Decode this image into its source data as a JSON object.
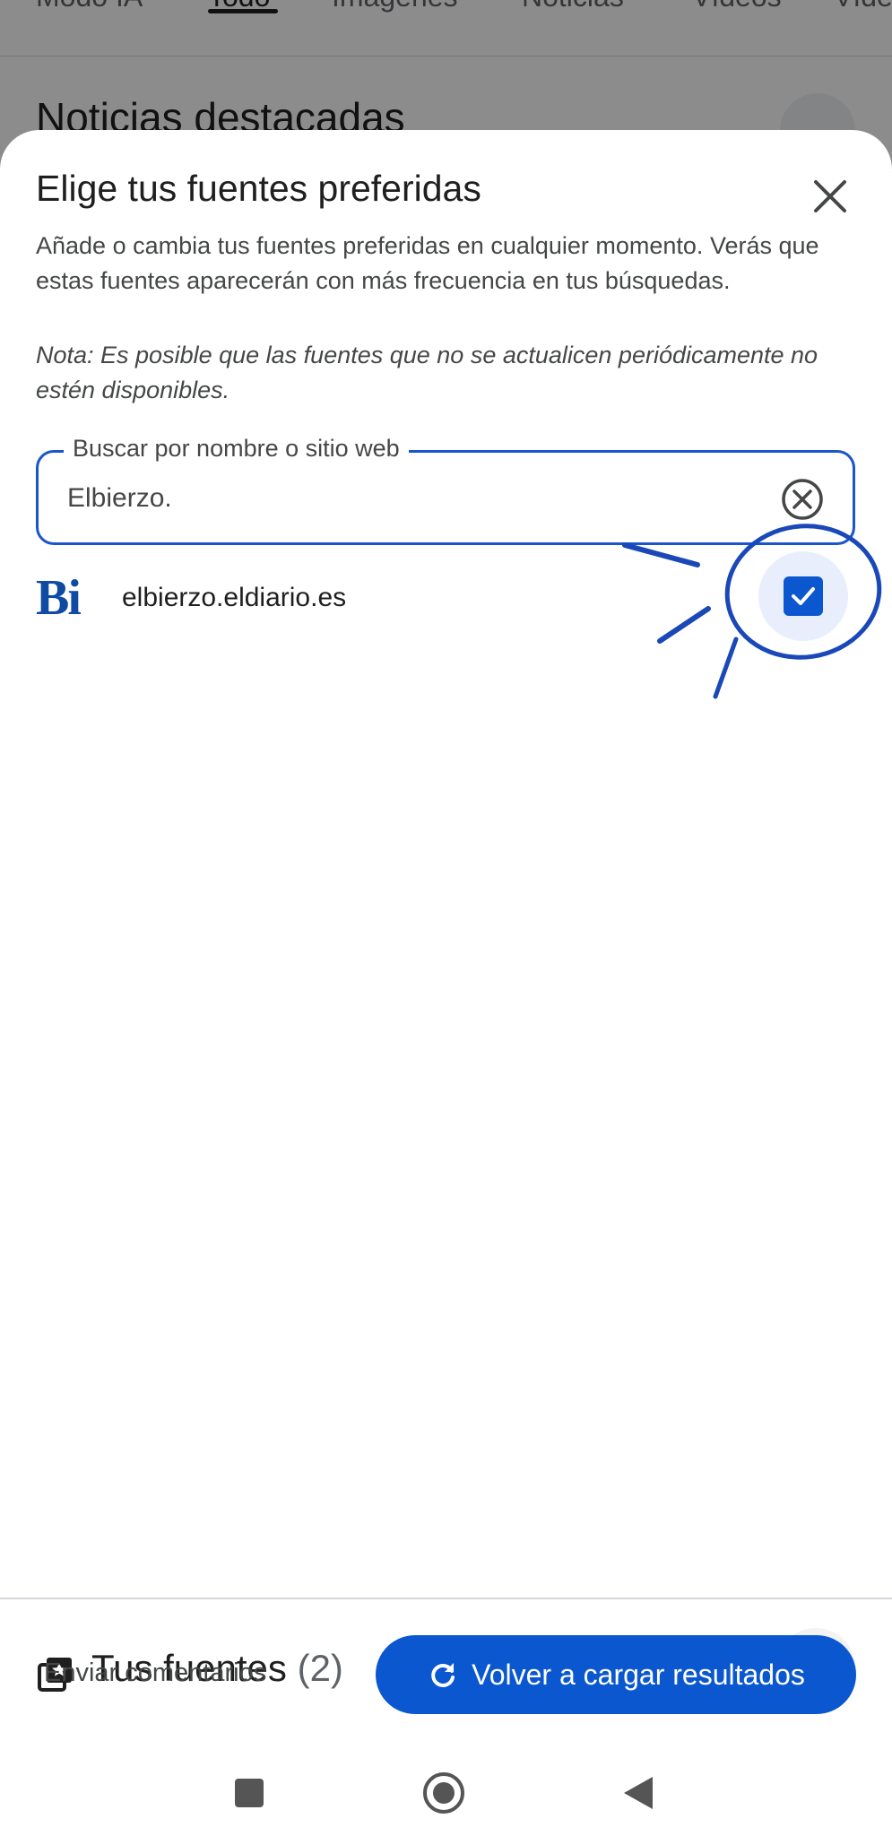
{
  "background": {
    "tabs": [
      {
        "label": "Modo IA"
      },
      {
        "label": "Todo",
        "active": true
      },
      {
        "label": "Imágenes"
      },
      {
        "label": "Noticias"
      },
      {
        "label": "Vídeos"
      },
      {
        "label": "Víde"
      }
    ],
    "heading": "Noticias destacadas"
  },
  "sheet": {
    "title": "Elige tus fuentes preferidas",
    "description": "Añade o cambia tus fuentes preferidas en cualquier momento. Verás que estas fuentes aparecerán con más frecuencia en tus búsquedas.",
    "note": "Nota: Es posible que las fuentes que no se actualicen periódicamente no estén disponibles.",
    "search": {
      "label": "Buscar por nombre o sitio web",
      "value": "Elbierzo."
    },
    "result": {
      "logo_text": "Bi",
      "name": "elbierzo.eldiario.es",
      "checked": true
    },
    "sources": {
      "title": "Tus fuentes",
      "count": "(2)"
    },
    "footer": {
      "feedback_label": "Enviar comentarios",
      "reload_label": "Volver a cargar resultados"
    }
  },
  "icons": {
    "close": "close-icon",
    "clear": "clear-circle-icon",
    "check": "check-icon",
    "sources": "starred-library-icon",
    "expand": "chevron-down-icon",
    "reload": "refresh-icon",
    "nav": [
      "recents-square-icon",
      "home-circle-icon",
      "back-triangle-icon"
    ]
  },
  "colors": {
    "accent": "#0b57d0",
    "annotation": "#1a48b8",
    "scrim": "rgba(0,0,0,0.45)"
  }
}
